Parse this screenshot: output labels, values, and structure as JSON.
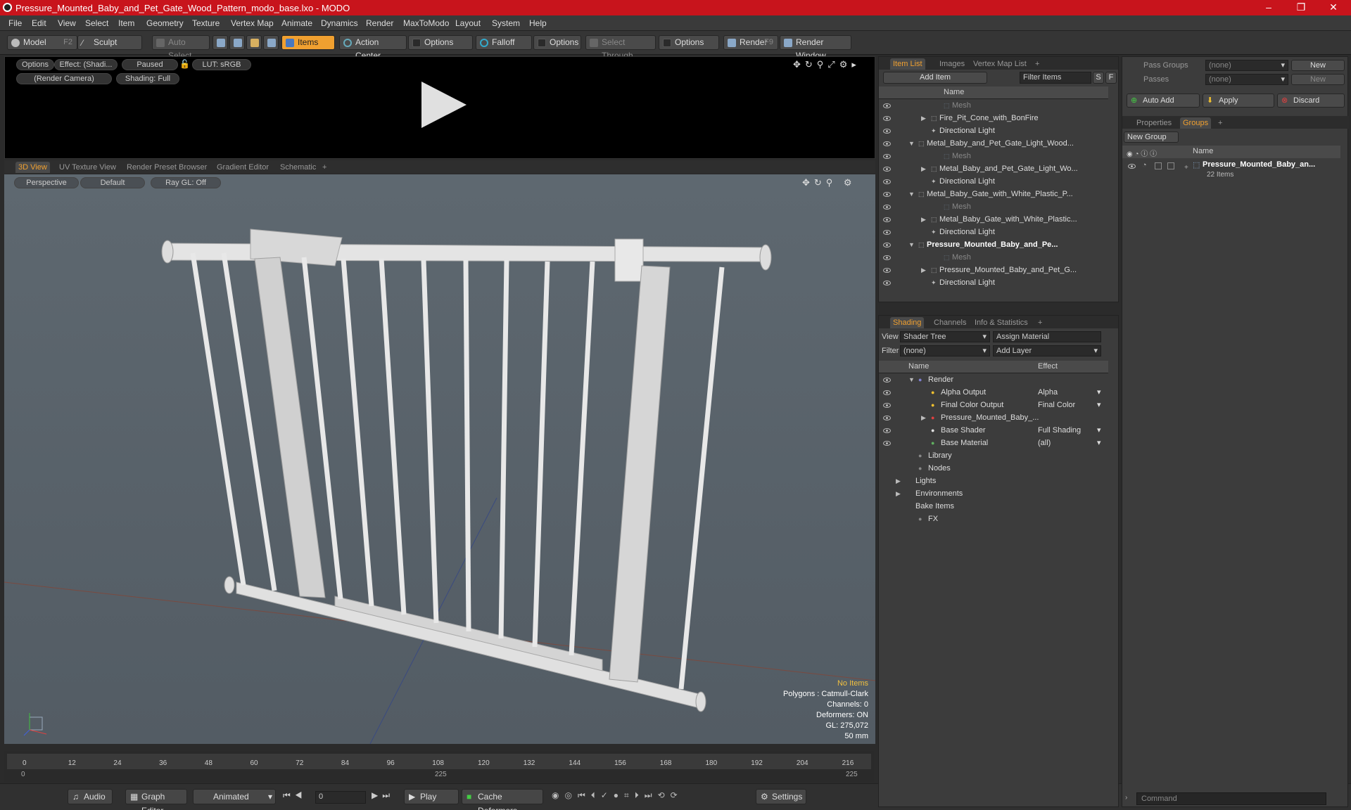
{
  "window": {
    "title": "Pressure_Mounted_Baby_and_Pet_Gate_Wood_Pattern_modo_base.lxo - MODO",
    "controls": [
      "–",
      "❐",
      "✕"
    ]
  },
  "menu": [
    "File",
    "Edit",
    "View",
    "Select",
    "Item",
    "Geometry",
    "Texture",
    "Vertex Map",
    "Animate",
    "Dynamics",
    "Render",
    "MaxToModo",
    "Layout",
    "System",
    "Help"
  ],
  "toolbar": {
    "model": "Model",
    "model_key": "F2",
    "sculpt": "Sculpt",
    "auto_select": "Auto Select",
    "items": "Items",
    "action_center": "Action Center",
    "options1": "Options",
    "falloff": "Falloff",
    "options2": "Options",
    "select_through": "Select Through",
    "options3": "Options",
    "render": "Render",
    "render_key": "F9",
    "render_window": "Render Window"
  },
  "preview": {
    "options": "Options",
    "effect": "Effect: (Shadi...",
    "paused": "Paused",
    "lut": "LUT: sRGB",
    "camera": "(Render Camera)",
    "shading": "Shading: Full"
  },
  "viewport_tabs": [
    "3D View",
    "UV Texture View",
    "Render Preset Browser",
    "Gradient Editor",
    "Schematic",
    "+"
  ],
  "viewport": {
    "perspective": "Perspective",
    "default": "Default",
    "raygl": "Ray GL: Off",
    "info": {
      "no_items": "No Items",
      "polygons": "Polygons : Catmull-Clark",
      "channels": "Channels: 0",
      "deformers": "Deformers: ON",
      "gl": "GL: 275,072",
      "lens": "50 mm"
    }
  },
  "timeline": {
    "ticks": [
      "0",
      "12",
      "24",
      "36",
      "48",
      "60",
      "72",
      "84",
      "96",
      "108",
      "120",
      "132",
      "144",
      "156",
      "168",
      "180",
      "192",
      "204",
      "216"
    ],
    "start": "0",
    "mid": "225",
    "end": "225"
  },
  "bottombar": {
    "audio": "Audio",
    "graph_editor": "Graph Editor",
    "animated": "Animated",
    "frame": "0",
    "play": "Play",
    "cache": "Cache Deformers",
    "settings": "Settings"
  },
  "item_list": {
    "tabs": [
      "Item List",
      "Images",
      "Vertex Map List",
      "+"
    ],
    "add_item": "Add Item",
    "filter": "Filter Items",
    "s": "S",
    "f": "F",
    "col_name": "Name",
    "rows": [
      {
        "label": "Mesh",
        "indent": 4,
        "dim": true,
        "tri": ""
      },
      {
        "label": "Fire_Pit_Cone_with_BonFire",
        "indent": 3,
        "dim": false,
        "tri": "▶"
      },
      {
        "label": "Directional Light",
        "indent": 3,
        "dim": false,
        "tri": ""
      },
      {
        "label": "Metal_Baby_and_Pet_Gate_Light_Wood...",
        "indent": 2,
        "dim": false,
        "tri": "▼"
      },
      {
        "label": "Mesh",
        "indent": 4,
        "dim": true,
        "tri": ""
      },
      {
        "label": "Metal_Baby_and_Pet_Gate_Light_Wo...",
        "indent": 3,
        "dim": false,
        "tri": "▶"
      },
      {
        "label": "Directional Light",
        "indent": 3,
        "dim": false,
        "tri": ""
      },
      {
        "label": "Metal_Baby_Gate_with_White_Plastic_P...",
        "indent": 2,
        "dim": false,
        "tri": "▼"
      },
      {
        "label": "Mesh",
        "indent": 4,
        "dim": true,
        "tri": ""
      },
      {
        "label": "Metal_Baby_Gate_with_White_Plastic...",
        "indent": 3,
        "dim": false,
        "tri": "▶"
      },
      {
        "label": "Directional Light",
        "indent": 3,
        "dim": false,
        "tri": ""
      },
      {
        "label": "Pressure_Mounted_Baby_and_Pe...",
        "indent": 2,
        "dim": false,
        "tri": "▼",
        "bold": true
      },
      {
        "label": "Mesh",
        "indent": 4,
        "dim": true,
        "tri": ""
      },
      {
        "label": "Pressure_Mounted_Baby_and_Pet_G...",
        "indent": 3,
        "dim": false,
        "tri": "▶"
      },
      {
        "label": "Directional Light",
        "indent": 3,
        "dim": false,
        "tri": ""
      }
    ]
  },
  "shading": {
    "tabs": [
      "Shading",
      "Channels",
      "Info & Statistics",
      "+"
    ],
    "view_label": "View",
    "view_value": "Shader Tree",
    "assign": "Assign Material",
    "filter_label": "Filter",
    "filter_value": "(none)",
    "add_layer": "Add Layer",
    "col_name": "Name",
    "col_effect": "Effect",
    "rows": [
      {
        "label": "Render",
        "effect": "",
        "indent": 1,
        "tri": "▼",
        "eye": true
      },
      {
        "label": "Alpha Output",
        "effect": "Alpha",
        "indent": 2,
        "tri": "",
        "eye": true
      },
      {
        "label": "Final Color Output",
        "effect": "Final Color",
        "indent": 2,
        "tri": "",
        "eye": true
      },
      {
        "label": "Pressure_Mounted_Baby_...",
        "effect": "",
        "indent": 2,
        "tri": "▶",
        "eye": true
      },
      {
        "label": "Base Shader",
        "effect": "Full Shading",
        "indent": 2,
        "tri": "",
        "eye": true
      },
      {
        "label": "Base Material",
        "effect": "(all)",
        "indent": 2,
        "tri": "",
        "eye": true
      },
      {
        "label": "Library",
        "effect": "",
        "indent": 1,
        "tri": "",
        "eye": false
      },
      {
        "label": "Nodes",
        "effect": "",
        "indent": 1,
        "tri": "",
        "eye": false
      },
      {
        "label": "Lights",
        "effect": "",
        "indent": 0,
        "tri": "▶",
        "eye": false
      },
      {
        "label": "Environments",
        "effect": "",
        "indent": 0,
        "tri": "▶",
        "eye": false
      },
      {
        "label": "Bake Items",
        "effect": "",
        "indent": 0,
        "tri": "",
        "eye": false
      },
      {
        "label": "FX",
        "effect": "",
        "indent": 1,
        "tri": "",
        "eye": false
      }
    ]
  },
  "groups": {
    "pass_groups": "Pass Groups",
    "passes": "Passes",
    "none": "(none)",
    "new": "New",
    "auto_add": "Auto Add",
    "apply": "Apply",
    "discard": "Discard",
    "tabs": [
      "Properties",
      "Groups",
      "+"
    ],
    "new_group": "New Group",
    "col_name": "Name",
    "item_name": "Pressure_Mounted_Baby_an...",
    "item_count": "22 Items"
  },
  "command": "Command",
  "colors": {
    "accent": "#f0a030",
    "title_red": "#c8141c"
  }
}
